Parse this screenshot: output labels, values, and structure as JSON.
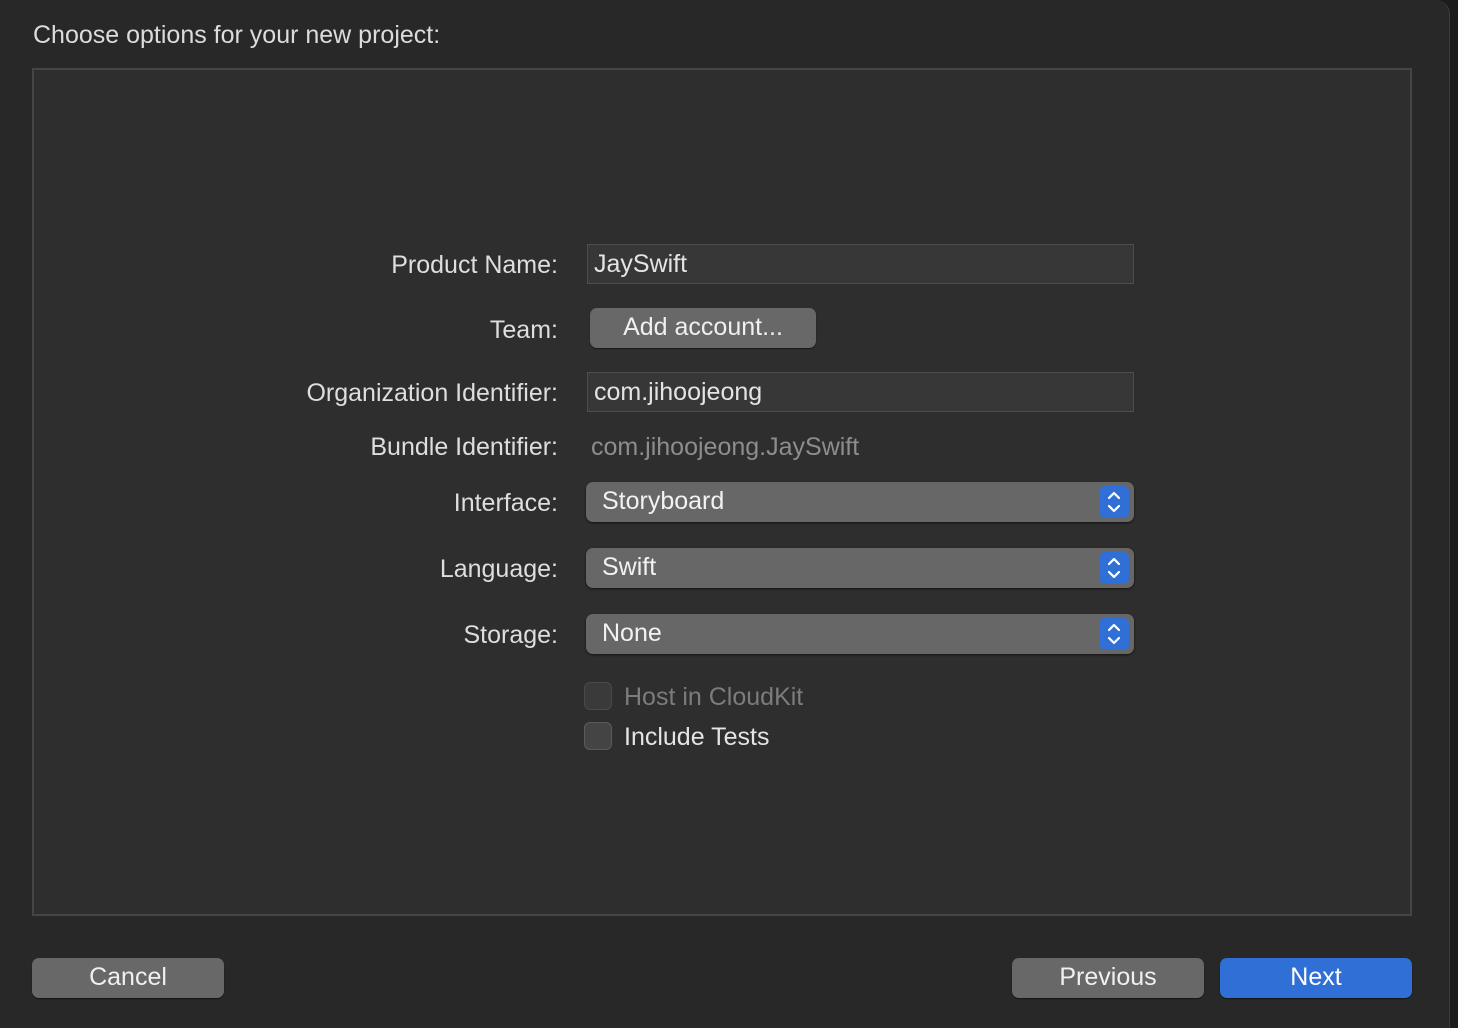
{
  "dialog": {
    "heading": "Choose options for your new project:"
  },
  "form": {
    "product_name": {
      "label": "Product Name:",
      "value": "JaySwift"
    },
    "team": {
      "label": "Team:",
      "button_label": "Add account..."
    },
    "organization_identifier": {
      "label": "Organization Identifier:",
      "value": "com.jihoojeong"
    },
    "bundle_identifier": {
      "label": "Bundle Identifier:",
      "value": "com.jihoojeong.JaySwift"
    },
    "interface": {
      "label": "Interface:",
      "selected": "Storyboard"
    },
    "language": {
      "label": "Language:",
      "selected": "Swift"
    },
    "storage": {
      "label": "Storage:",
      "selected": "None"
    },
    "host_in_cloudkit": {
      "label": "Host in CloudKit",
      "checked": false,
      "enabled": false
    },
    "include_tests": {
      "label": "Include Tests",
      "checked": false,
      "enabled": true
    }
  },
  "footer": {
    "cancel_label": "Cancel",
    "previous_label": "Previous",
    "next_label": "Next"
  },
  "colors": {
    "accent": "#2f6fd6",
    "background": "#282828",
    "panel": "#2e2e2e"
  },
  "icons": {
    "popup_stepper": "chevron-up-down-icon"
  }
}
